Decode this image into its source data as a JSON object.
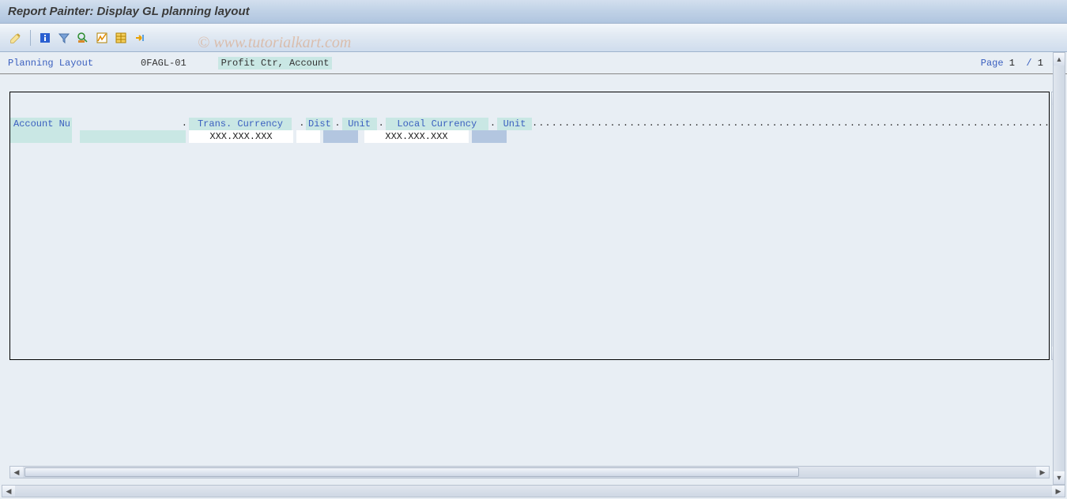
{
  "title": "Report Painter: Display GL planning layout",
  "watermark": "© www.tutorialkart.com",
  "toolbar": {
    "icons": [
      "edit",
      "info",
      "filter",
      "overview",
      "highlight",
      "layout",
      "export"
    ]
  },
  "info": {
    "label": "Planning Layout",
    "code": "0FAGL-01",
    "desc": "Profit Ctr, Account",
    "page_label": "Page",
    "page_current": "1",
    "page_sep": "/",
    "page_total": "1"
  },
  "grid": {
    "headers": {
      "account": "Account Nu",
      "trans_currency": "Trans. Currency",
      "dist": "Dist",
      "unit1": "Unit",
      "local_currency": "Local Currency",
      "unit2": "Unit"
    },
    "row": {
      "trans_value": "XXX.XXX.XXX",
      "local_value": "XXX.XXX.XXX"
    }
  }
}
